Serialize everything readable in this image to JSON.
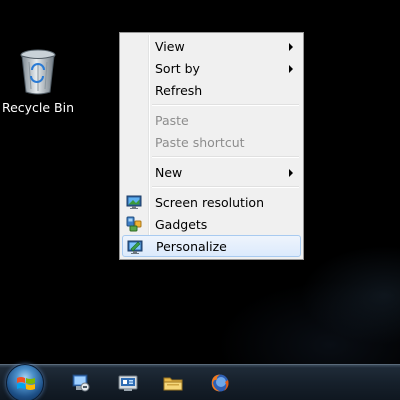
{
  "desktop": {
    "icons": [
      {
        "label": "Recycle Bin",
        "icon": "recycle-bin-icon"
      }
    ]
  },
  "context_menu": {
    "items": [
      {
        "label": "View",
        "enabled": true,
        "submenu": true
      },
      {
        "label": "Sort by",
        "enabled": true,
        "submenu": true
      },
      {
        "label": "Refresh",
        "enabled": true
      },
      {
        "label": "Paste",
        "enabled": false
      },
      {
        "label": "Paste shortcut",
        "enabled": false
      },
      {
        "label": "New",
        "enabled": true,
        "submenu": true
      },
      {
        "label": "Screen resolution",
        "enabled": true,
        "icon": "screen-resolution-icon"
      },
      {
        "label": "Gadgets",
        "enabled": true,
        "icon": "gadgets-icon"
      },
      {
        "label": "Personalize",
        "enabled": true,
        "icon": "personalize-icon",
        "highlighted": true
      }
    ]
  },
  "taskbar": {
    "start_button": "windows-logo-icon",
    "pinned": [
      {
        "icon": "control-panel-icon"
      },
      {
        "icon": "device-manager-icon"
      },
      {
        "icon": "windows-explorer-icon"
      },
      {
        "icon": "firefox-icon"
      }
    ]
  },
  "colors": {
    "desktop_background": "#000000",
    "menu_background": "#f0f0f0",
    "menu_highlight_border": "#a8caf0",
    "disabled_text": "#8d8d8d",
    "taskbar": "#16202b"
  }
}
